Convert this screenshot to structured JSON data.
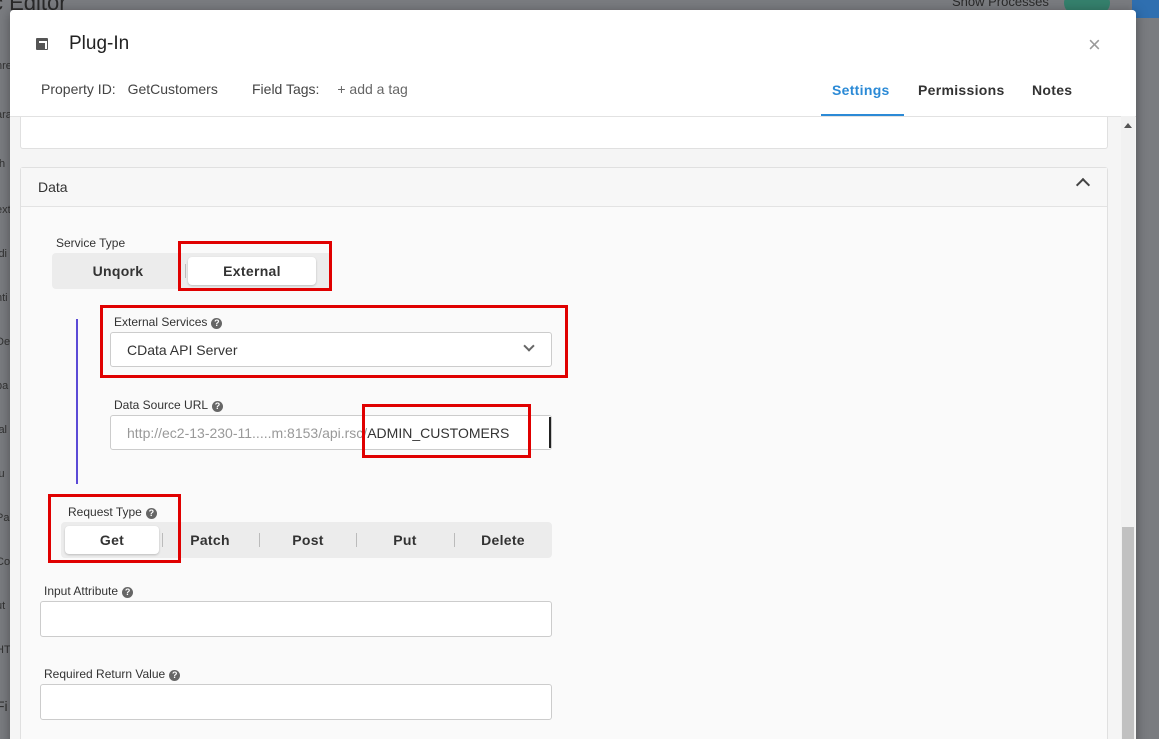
{
  "background": {
    "app_title": "c Editor",
    "show_processes": "Show Processes",
    "side_fragments": [
      "nre",
      "ara",
      "th",
      "ext",
      "idi",
      "nti",
      "Des",
      "pa",
      "lal",
      "lu",
      "Pa",
      "Co",
      "ut",
      "HT",
      "Fi"
    ]
  },
  "modal": {
    "title": "Plug-In",
    "close_glyph": "×",
    "property_id_label": "Property ID:",
    "property_id_value": "GetCustomers",
    "field_tags_label": "Field Tags:",
    "add_tag_label": "+ add a tag",
    "tabs": [
      {
        "label": "Settings",
        "active": true
      },
      {
        "label": "Permissions",
        "active": false
      },
      {
        "label": "Notes",
        "active": false
      }
    ],
    "accent_color": "#2b8ad6"
  },
  "data_panel": {
    "title": "Data",
    "service_type": {
      "label": "Service Type",
      "options": [
        "Unqork",
        "External"
      ],
      "selected": "External"
    },
    "external_services": {
      "label": "External Services",
      "help_glyph": "?",
      "value": "CData API Server"
    },
    "data_source_url": {
      "label": "Data Source URL",
      "help_glyph": "?",
      "prefix": "http://ec2-13-230-11.....m:8153/api.rsc/",
      "suffix": "ADMIN_CUSTOMERS"
    },
    "request_type": {
      "label": "Request Type",
      "help_glyph": "?",
      "options": [
        "Get",
        "Patch",
        "Post",
        "Put",
        "Delete"
      ],
      "selected": "Get"
    },
    "input_attribute": {
      "label": "Input Attribute",
      "help_glyph": "?",
      "value": ""
    },
    "required_return_value": {
      "label": "Required Return Value",
      "help_glyph": "?",
      "value": ""
    }
  },
  "highlight_color": "#e00000"
}
